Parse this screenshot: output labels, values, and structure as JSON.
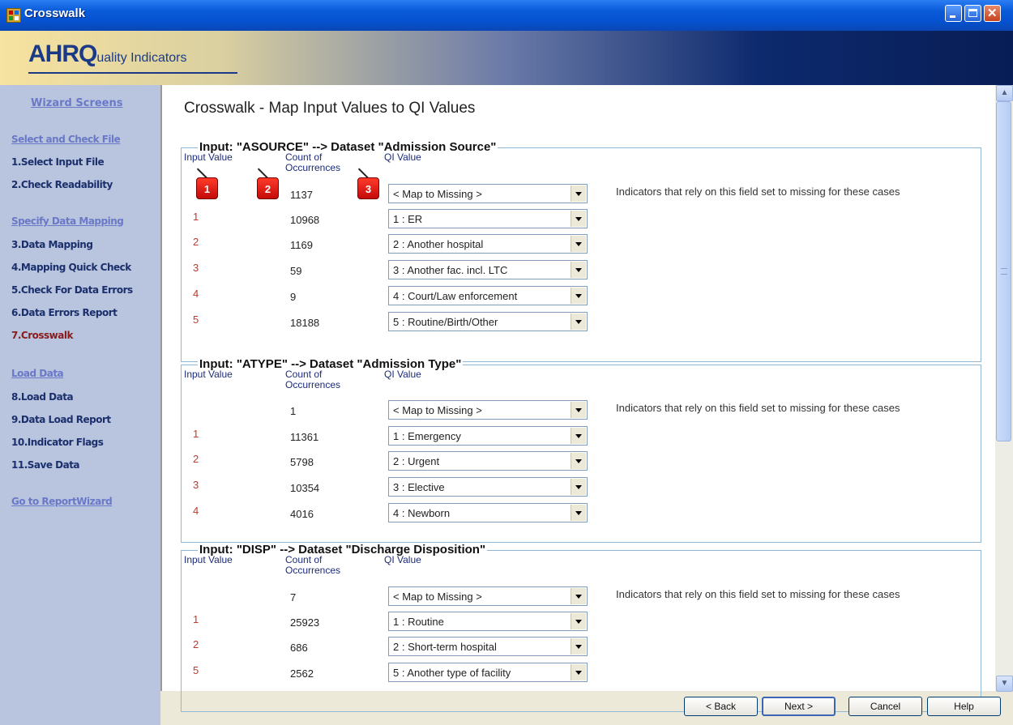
{
  "window": {
    "title": "Crosswalk"
  },
  "banner": {
    "logo_prefix": "AHRQ",
    "logo_suffix": "uality Indicators"
  },
  "sidebar": {
    "title": "Wizard Screens",
    "sections": [
      {
        "header": "Select and Check File",
        "items": [
          "1.Select Input File",
          "2.Check Readability"
        ]
      },
      {
        "header": "Specify Data Mapping",
        "items": [
          "3.Data Mapping",
          "4.Mapping Quick Check",
          "5.Check For Data Errors",
          "6.Data Errors Report",
          "7.Crosswalk"
        ]
      },
      {
        "header": "Load Data",
        "items": [
          "8.Load Data",
          "9.Data Load Report",
          "10.Indicator Flags",
          "11.Save Data"
        ]
      }
    ],
    "link": "Go to ReportWizard",
    "active_item": "7.Crosswalk"
  },
  "main": {
    "title": "Crosswalk - Map Input Values to QI Values",
    "columns": {
      "input": "Input Value",
      "count_line1": "Count of",
      "count_line2": "Occurrences",
      "qi": "QI Value"
    },
    "badges": [
      "1",
      "2",
      "3"
    ],
    "note": "Indicators that rely on this field set to missing for these cases",
    "groups": [
      {
        "title": "Input: \"ASOURCE\" --> Dataset \"Admission Source\"",
        "rows": [
          {
            "input": "",
            "count": "1137",
            "qi": "< Map to Missing >"
          },
          {
            "input": "1",
            "count": "10968",
            "qi": "1 : ER"
          },
          {
            "input": "2",
            "count": "1169",
            "qi": "2 : Another hospital"
          },
          {
            "input": "3",
            "count": "59",
            "qi": "3 : Another fac. incl. LTC"
          },
          {
            "input": "4",
            "count": "9",
            "qi": "4 : Court/Law enforcement"
          },
          {
            "input": "5",
            "count": "18188",
            "qi": "5 : Routine/Birth/Other"
          }
        ]
      },
      {
        "title": "Input: \"ATYPE\" --> Dataset \"Admission Type\"",
        "rows": [
          {
            "input": "",
            "count": "1",
            "qi": "< Map to Missing >"
          },
          {
            "input": "1",
            "count": "11361",
            "qi": "1 : Emergency"
          },
          {
            "input": "2",
            "count": "5798",
            "qi": "2 : Urgent"
          },
          {
            "input": "3",
            "count": "10354",
            "qi": "3 : Elective"
          },
          {
            "input": "4",
            "count": "4016",
            "qi": "4 : Newborn"
          }
        ]
      },
      {
        "title": "Input: \"DISP\" --> Dataset \"Discharge Disposition\"",
        "rows": [
          {
            "input": "",
            "count": "7",
            "qi": "< Map to Missing >"
          },
          {
            "input": "1",
            "count": "25923",
            "qi": "1 : Routine"
          },
          {
            "input": "2",
            "count": "686",
            "qi": "2 : Short-term hospital"
          },
          {
            "input": "5",
            "count": "2562",
            "qi": "5 : Another type of facility"
          }
        ]
      }
    ]
  },
  "buttons": {
    "back": "< Back",
    "next": "Next >",
    "cancel": "Cancel",
    "help": "Help"
  }
}
